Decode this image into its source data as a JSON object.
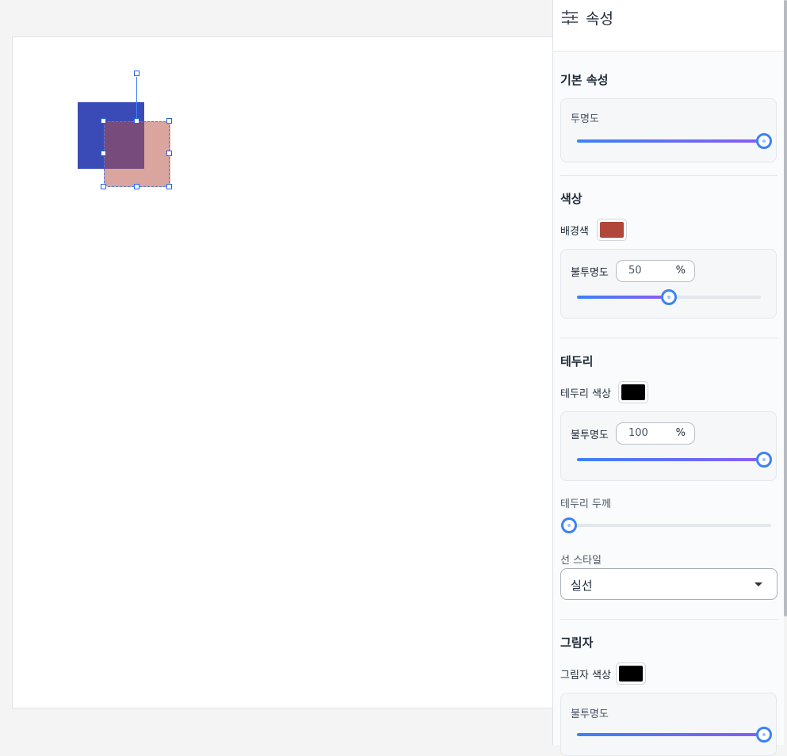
{
  "panel": {
    "title": "속성",
    "basic": {
      "title": "기본 속성",
      "opacity_label": "투명도",
      "opacity_value": 1.0
    },
    "color": {
      "title": "색상",
      "bg_label": "배경색",
      "bg_color": "#b0473a",
      "opacity_label": "불투명도",
      "opacity_value": "50",
      "opacity_unit": "%",
      "opacity_fraction": 0.5
    },
    "border": {
      "title": "테두리",
      "color_label": "테두리 색상",
      "color": "#000000",
      "opacity_label": "불투명도",
      "opacity_value": "100",
      "opacity_unit": "%",
      "opacity_fraction": 1.0,
      "width_label": "테두리 두께",
      "width_fraction": 0.0,
      "style_label": "선 스타일",
      "style_value": "실선"
    },
    "shadow": {
      "title": "그림자",
      "color_label": "그림자 색상",
      "color": "#000000",
      "opacity_label": "불투명도",
      "opacity_fraction": 1.0
    }
  },
  "canvas": {
    "shape1_color": "#3a4bb8",
    "shape2_color": "#b44b3e"
  }
}
